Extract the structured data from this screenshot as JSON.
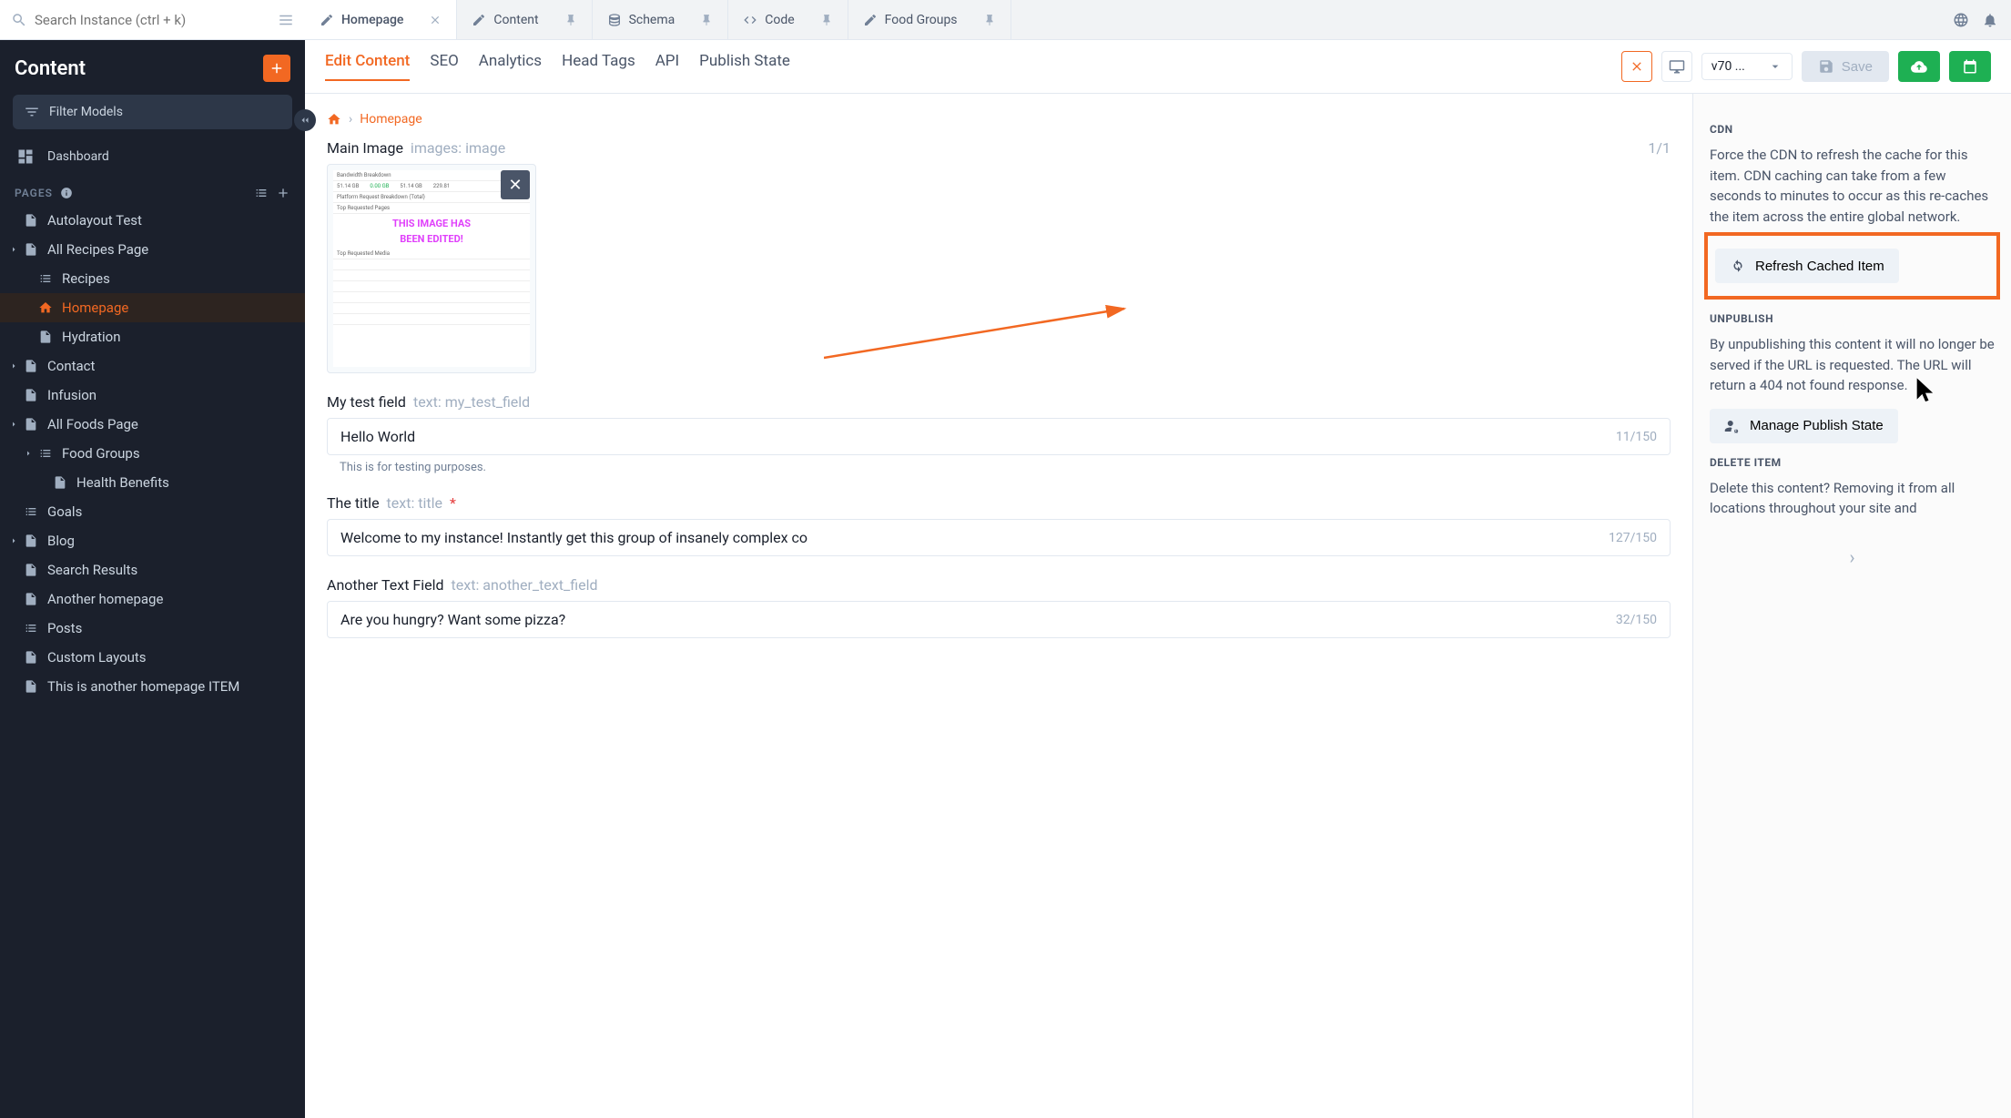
{
  "search": {
    "placeholder": "Search Instance (ctrl + k)"
  },
  "top_tabs": [
    {
      "label": "Homepage",
      "icon": "pencil",
      "active": true,
      "pin": "close"
    },
    {
      "label": "Content",
      "icon": "pencil",
      "active": false,
      "pin": "pin"
    },
    {
      "label": "Schema",
      "icon": "db",
      "active": false,
      "pin": "pin"
    },
    {
      "label": "Code",
      "icon": "code",
      "active": false,
      "pin": "pin"
    },
    {
      "label": "Food Groups",
      "icon": "pencil",
      "active": false,
      "pin": "pin"
    }
  ],
  "sidebar": {
    "title": "Content",
    "filter_label": "Filter Models",
    "dashboard": "Dashboard",
    "section_label": "PAGES",
    "nav": [
      {
        "label": "Autolayout Test",
        "icon": "doc",
        "depth": 1,
        "caret": false
      },
      {
        "label": "All Recipes Page",
        "icon": "doc",
        "depth": 1,
        "caret": true
      },
      {
        "label": "Recipes",
        "icon": "list",
        "depth": 2,
        "caret": false
      },
      {
        "label": "Homepage",
        "icon": "home",
        "depth": 2,
        "caret": false,
        "active": true
      },
      {
        "label": "Hydration",
        "icon": "doc",
        "depth": 2,
        "caret": false
      },
      {
        "label": "Contact",
        "icon": "doc",
        "depth": 1,
        "caret": true
      },
      {
        "label": "Infusion",
        "icon": "doc",
        "depth": 1,
        "caret": false
      },
      {
        "label": "All Foods Page",
        "icon": "doc",
        "depth": 1,
        "caret": true
      },
      {
        "label": "Food Groups",
        "icon": "list",
        "depth": 2,
        "caret": true
      },
      {
        "label": "Health Benefits",
        "icon": "doc",
        "depth": 3,
        "caret": false
      },
      {
        "label": "Goals",
        "icon": "list",
        "depth": 1,
        "caret": false
      },
      {
        "label": "Blog",
        "icon": "doc",
        "depth": 1,
        "caret": true
      },
      {
        "label": "Search Results",
        "icon": "doc",
        "depth": 1,
        "caret": false
      },
      {
        "label": "Another homepage",
        "icon": "doc",
        "depth": 1,
        "caret": false
      },
      {
        "label": "Posts",
        "icon": "list",
        "depth": 1,
        "caret": false
      },
      {
        "label": "Custom Layouts",
        "icon": "doc",
        "depth": 1,
        "caret": false
      },
      {
        "label": "This is another homepage ITEM",
        "icon": "doc",
        "depth": 1,
        "caret": false
      }
    ]
  },
  "secondary_tabs": [
    "Edit Content",
    "SEO",
    "Analytics",
    "Head Tags",
    "API",
    "Publish State"
  ],
  "secondary_active": "Edit Content",
  "version": "v70 ...",
  "save_label": "Save",
  "breadcrumb": "Homepage",
  "fields": {
    "main_image": {
      "label": "Main Image",
      "meta": "images: image",
      "count": "1/1",
      "banner_line1": "THIS IMAGE HAS",
      "banner_line2": "BEEN EDITED!"
    },
    "test": {
      "label": "My test field",
      "meta": "text: my_test_field",
      "value": "Hello World",
      "count": "11/150",
      "help": "This is for testing purposes."
    },
    "title": {
      "label": "The title",
      "meta": "text: title",
      "required": true,
      "value": "Welcome to my instance! Instantly get this group of insanely complex co",
      "count": "127/150"
    },
    "another": {
      "label": "Another Text Field",
      "meta": "text: another_text_field",
      "value": "Are you hungry? Want some pizza?",
      "count": "32/150"
    }
  },
  "rightpanel": {
    "cdn_title": "CDN",
    "cdn_text": "Force the CDN to refresh the cache for this item. CDN caching can take from a few seconds to minutes to occur as this re-caches the item across the entire global network.",
    "cdn_btn": "Refresh Cached Item",
    "unpublish_title": "UNPUBLISH",
    "unpublish_text": "By unpublishing this content it will no longer be served if the URL is requested. The URL will return a 404 not found response.",
    "unpublish_btn": "Manage Publish State",
    "delete_title": "DELETE ITEM",
    "delete_text": "Delete this content? Removing it from all locations throughout your site and"
  }
}
